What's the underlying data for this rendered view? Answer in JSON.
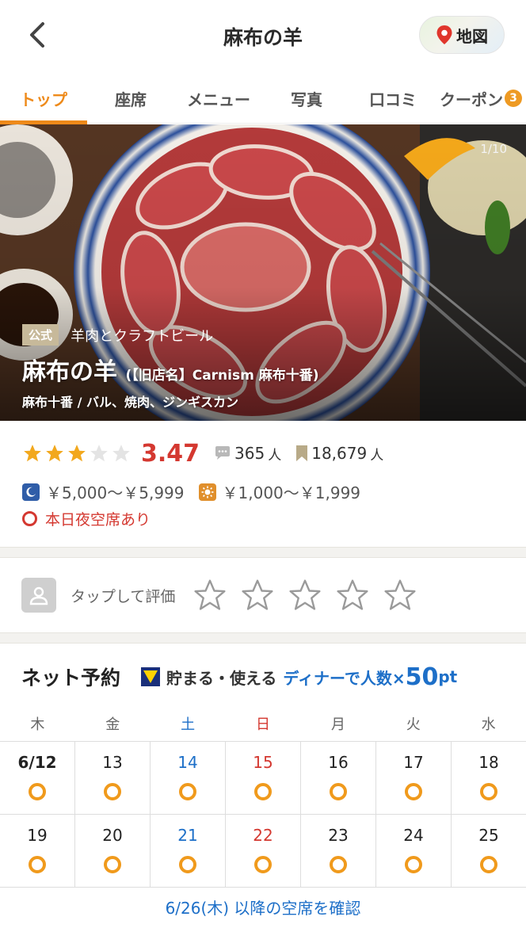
{
  "header": {
    "title": "麻布の羊",
    "map_label": "地図"
  },
  "tabs": [
    {
      "label": "トップ",
      "active": true
    },
    {
      "label": "座席"
    },
    {
      "label": "メニュー"
    },
    {
      "label": "写真"
    },
    {
      "label": "口コミ"
    },
    {
      "label": "クーポン",
      "badge": "3"
    }
  ],
  "hero": {
    "counter": "1/10",
    "official_label": "公式",
    "catchphrase": "羊肉とクラフトビール",
    "shop_name": "麻布の羊",
    "former_name": "(【旧店名】Carnism 麻布十番)",
    "genre": "麻布十番 / バル、焼肉、ジンギスカン"
  },
  "rating": {
    "stars_filled": 3,
    "stars_total": 5,
    "score": "3.47",
    "reviews": "365",
    "reviews_unit": "人",
    "saves": "18,679",
    "saves_unit": "人"
  },
  "price": {
    "dinner": "￥5,000～￥5,999",
    "lunch": "￥1,000～￥1,999"
  },
  "vacancy_text": "本日夜空席あり",
  "review_prompt": "タップして評価",
  "reservation": {
    "title": "ネット予約",
    "tpoint_text": "貯まる・使える",
    "promo_text": "ディナーで人数×",
    "promo_points": "50",
    "promo_unit": "pt",
    "weekdays": [
      "木",
      "金",
      "土",
      "日",
      "月",
      "火",
      "水"
    ],
    "weeks": [
      [
        "6/12",
        "13",
        "14",
        "15",
        "16",
        "17",
        "18"
      ],
      [
        "19",
        "20",
        "21",
        "22",
        "23",
        "24",
        "25"
      ]
    ],
    "more_link": "6/26(木) 以降の空席を確認"
  },
  "colors": {
    "accent": "#ee8a1a",
    "score_red": "#d43830",
    "link_blue": "#1d6fc8",
    "star_yellow": "#f2a81d",
    "availability_ring": "#f09a1c"
  }
}
